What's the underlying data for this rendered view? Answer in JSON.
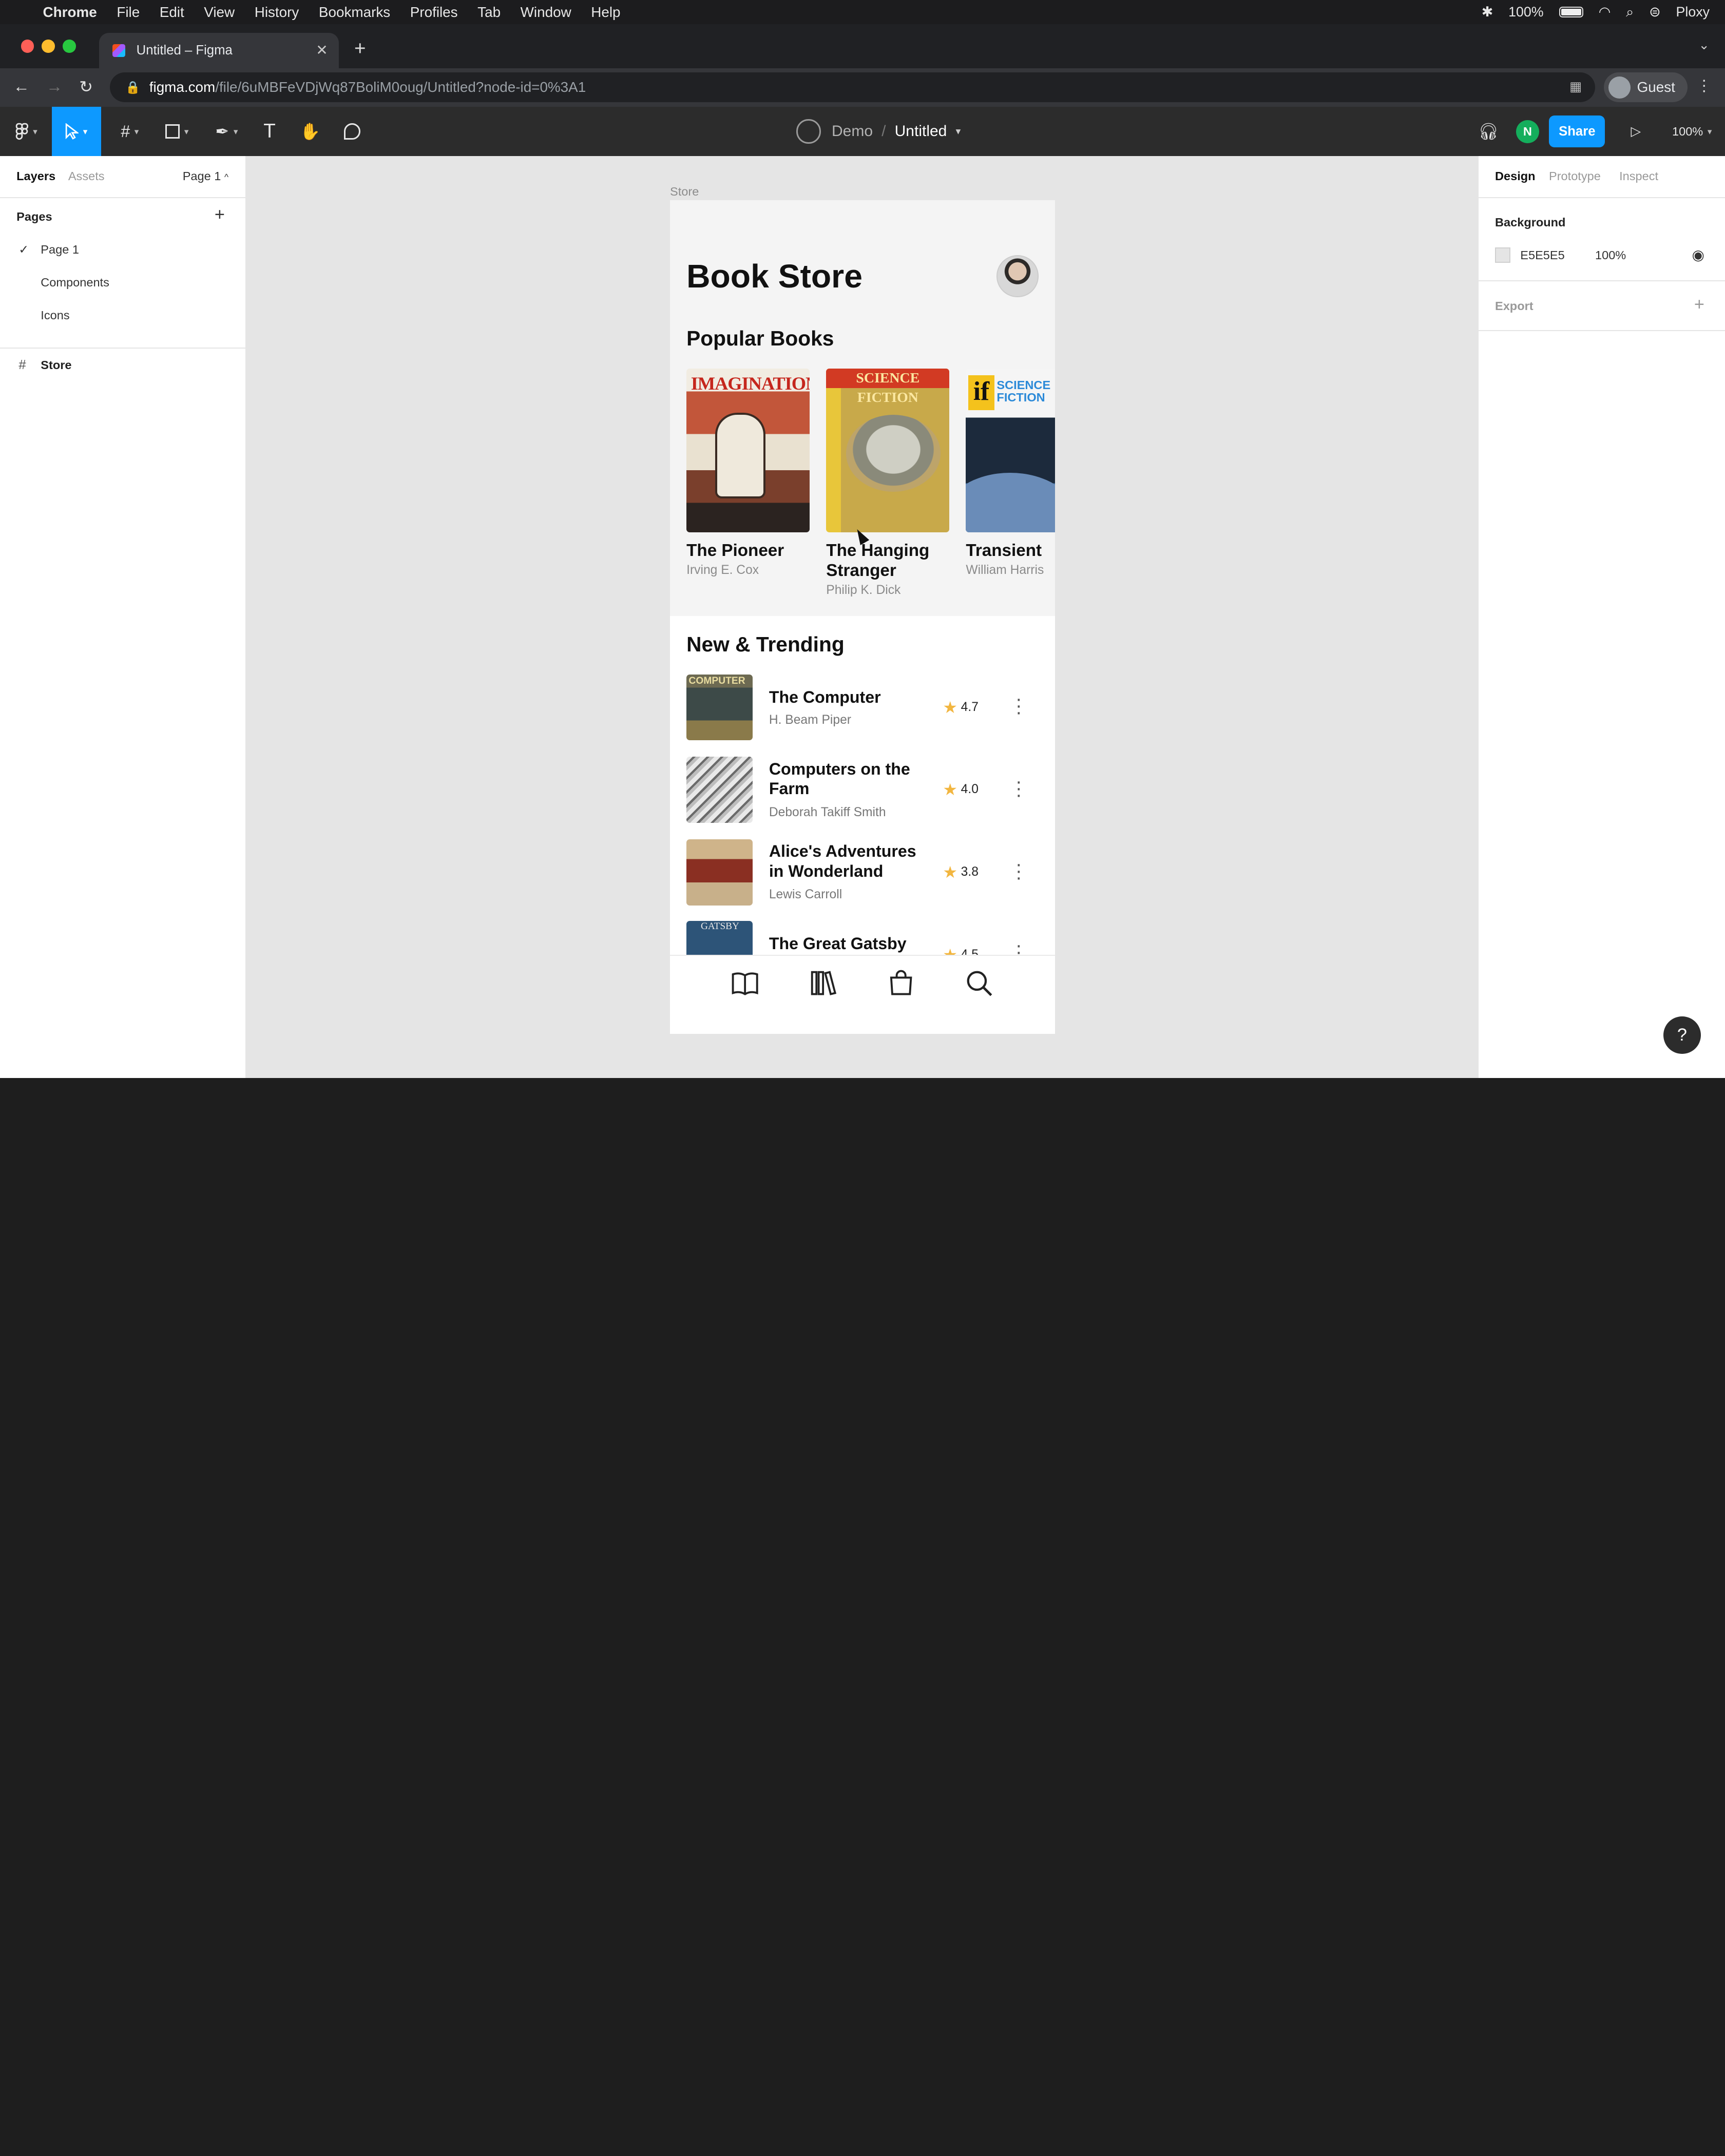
{
  "menubar": {
    "app": "Chrome",
    "items": [
      "File",
      "Edit",
      "View",
      "History",
      "Bookmarks",
      "Profiles",
      "Tab",
      "Window",
      "Help"
    ],
    "battery": "100%",
    "user": "Ploxy"
  },
  "browser": {
    "tab_title": "Untitled – Figma",
    "url_host": "figma.com",
    "url_path": "/file/6uMBFeVDjWq87BoliM0oug/Untitled?node-id=0%3A1",
    "profile": "Guest"
  },
  "figma": {
    "team": "Demo",
    "separator": "/",
    "file_name": "Untitled",
    "user_initial": "N",
    "share_label": "Share",
    "zoom": "100%"
  },
  "left_panel": {
    "tab_layers": "Layers",
    "tab_assets": "Assets",
    "page_selector": "Page 1",
    "pages_heading": "Pages",
    "add_icon": "+",
    "pages": [
      {
        "name": "Page 1",
        "selected": true
      },
      {
        "name": "Components",
        "selected": false
      },
      {
        "name": "Icons",
        "selected": false
      }
    ],
    "layer_frame_icon": "#",
    "layers": [
      {
        "name": "Store"
      }
    ]
  },
  "canvas": {
    "frame_label": "Store",
    "app_title": "Book Store",
    "popular_heading": "Popular Books",
    "popular_books": [
      {
        "title": "The Pioneer",
        "author": "Irving E. Cox"
      },
      {
        "title": "The Hanging Stranger",
        "author": "Philip K. Dick"
      },
      {
        "title": "Transient",
        "author": "William Harris"
      }
    ],
    "cover_text": {
      "imagination": "IMAGINATION",
      "sf_adventures": "SCIENCE FICTION",
      "if_logo": "if",
      "if_science": "SCIENCE",
      "if_fiction": "FICTION",
      "computer": "COMPUTER",
      "gatsby": "GATSBY"
    },
    "trending_heading": "New & Trending",
    "trending": [
      {
        "title": "The Computer",
        "author": "H. Beam Piper",
        "rating": "4.7"
      },
      {
        "title": "Computers on the Farm",
        "author": "Deborah Takiff Smith",
        "rating": "4.0"
      },
      {
        "title": "Alice's Adventures in Wonderland",
        "author": "Lewis Carroll",
        "rating": "3.8"
      },
      {
        "title": "The Great Gatsby",
        "author": "",
        "rating": "4.5"
      }
    ],
    "tabbar_icons": [
      "book-open-icon",
      "library-icon",
      "bag-icon",
      "search-icon"
    ]
  },
  "right_panel": {
    "tab_design": "Design",
    "tab_prototype": "Prototype",
    "tab_inspect": "Inspect",
    "background_heading": "Background",
    "background_hex": "E5E5E5",
    "background_opacity": "100%",
    "export_heading": "Export",
    "add_icon": "+"
  },
  "help_label": "?",
  "colors": {
    "figma_blue": "#0d99ff",
    "canvas_bg": "#E5E5E5",
    "star": "#f2b640"
  }
}
